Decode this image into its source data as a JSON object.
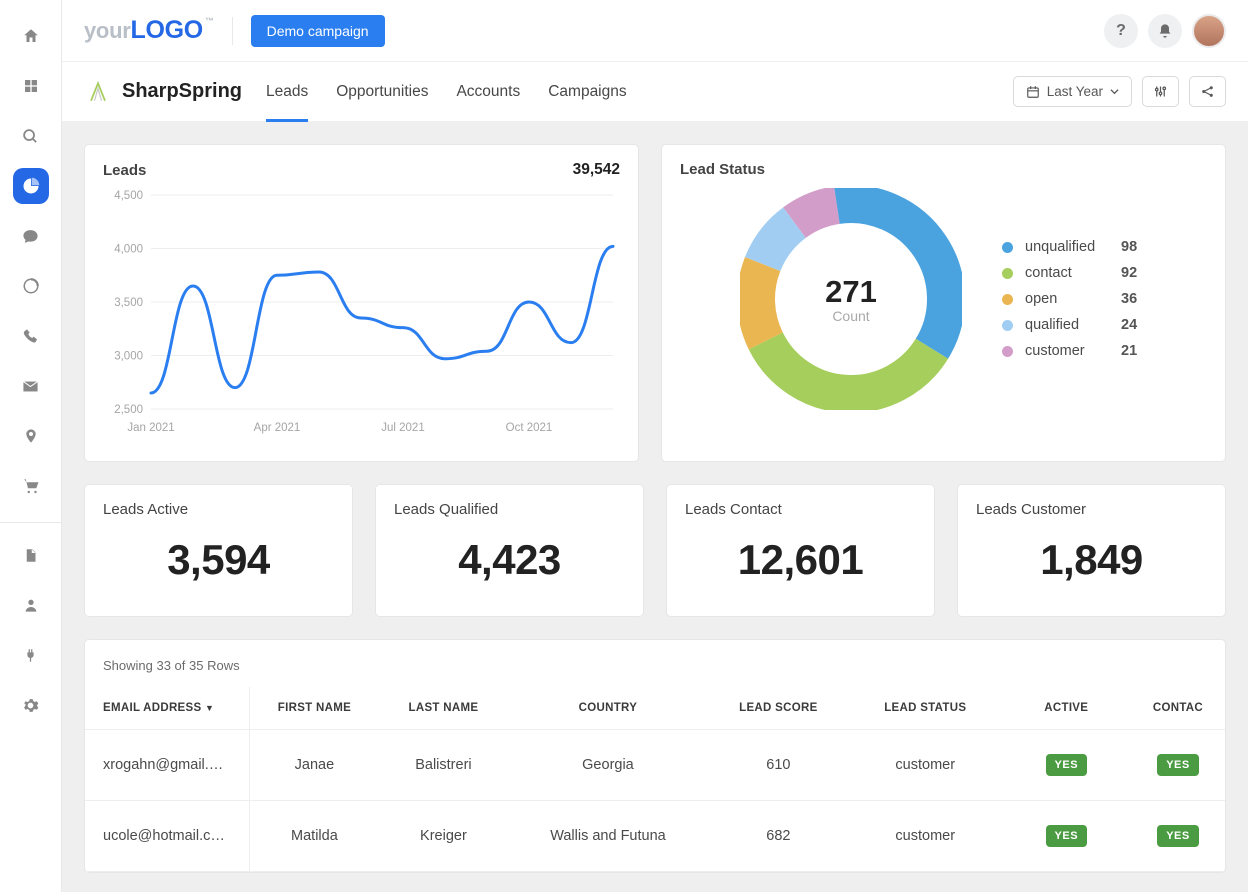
{
  "logo": {
    "part1": "your",
    "part2": "LOGO",
    "tm": "™"
  },
  "demo_btn": "Demo campaign",
  "app_name": "SharpSpring",
  "tabs": [
    "Leads",
    "Opportunities",
    "Accounts",
    "Campaigns"
  ],
  "active_tab": 0,
  "date_filter": "Last Year",
  "leads_card": {
    "title": "Leads",
    "value": "39,542"
  },
  "donut": {
    "title": "Lead Status",
    "total": "271",
    "label": "Count",
    "items": [
      {
        "name": "unqualified",
        "value": 98,
        "color": "#4aa3df"
      },
      {
        "name": "contact",
        "value": 92,
        "color": "#a6ce5c"
      },
      {
        "name": "open",
        "value": 36,
        "color": "#eab651"
      },
      {
        "name": "qualified",
        "value": 24,
        "color": "#a2cdf2"
      },
      {
        "name": "customer",
        "value": 21,
        "color": "#d39dc9"
      }
    ]
  },
  "stats": [
    {
      "label": "Leads Active",
      "value": "3,594"
    },
    {
      "label": "Leads Qualified",
      "value": "4,423"
    },
    {
      "label": "Leads Contact",
      "value": "12,601"
    },
    {
      "label": "Leads Customer",
      "value": "1,849"
    }
  ],
  "table": {
    "meta": "Showing 33 of 35 Rows",
    "headers": [
      "EMAIL ADDRESS",
      "FIRST NAME",
      "LAST NAME",
      "COUNTRY",
      "LEAD SCORE",
      "LEAD STATUS",
      "ACTIVE",
      "CONTAC"
    ],
    "rows": [
      {
        "email": "xrogahn@gmail.…",
        "first": "Janae",
        "last": "Balistreri",
        "country": "Georgia",
        "score": "610",
        "status": "customer",
        "active": "YES",
        "contact": "YES"
      },
      {
        "email": "ucole@hotmail.c…",
        "first": "Matilda",
        "last": "Kreiger",
        "country": "Wallis and Futuna",
        "score": "682",
        "status": "customer",
        "active": "YES",
        "contact": "YES"
      }
    ]
  },
  "chart_data": {
    "type": "line",
    "title": "Leads",
    "xlabel": "",
    "ylabel": "",
    "yticks": [
      2500,
      3000,
      3500,
      4000,
      4500
    ],
    "xticks": [
      "Jan 2021",
      "Apr 2021",
      "Jul 2021",
      "Oct 2021"
    ],
    "x": [
      "Jan 2021",
      "Feb 2021",
      "Mar 2021",
      "Apr 2021",
      "May 2021",
      "Jun 2021",
      "Jul 2021",
      "Aug 2021",
      "Sep 2021",
      "Oct 2021",
      "Nov 2021",
      "Dec 2021"
    ],
    "values": [
      2650,
      3650,
      2700,
      3750,
      3780,
      3350,
      3260,
      2970,
      3040,
      3500,
      3120,
      4020
    ],
    "ylim": [
      2500,
      4500
    ]
  }
}
